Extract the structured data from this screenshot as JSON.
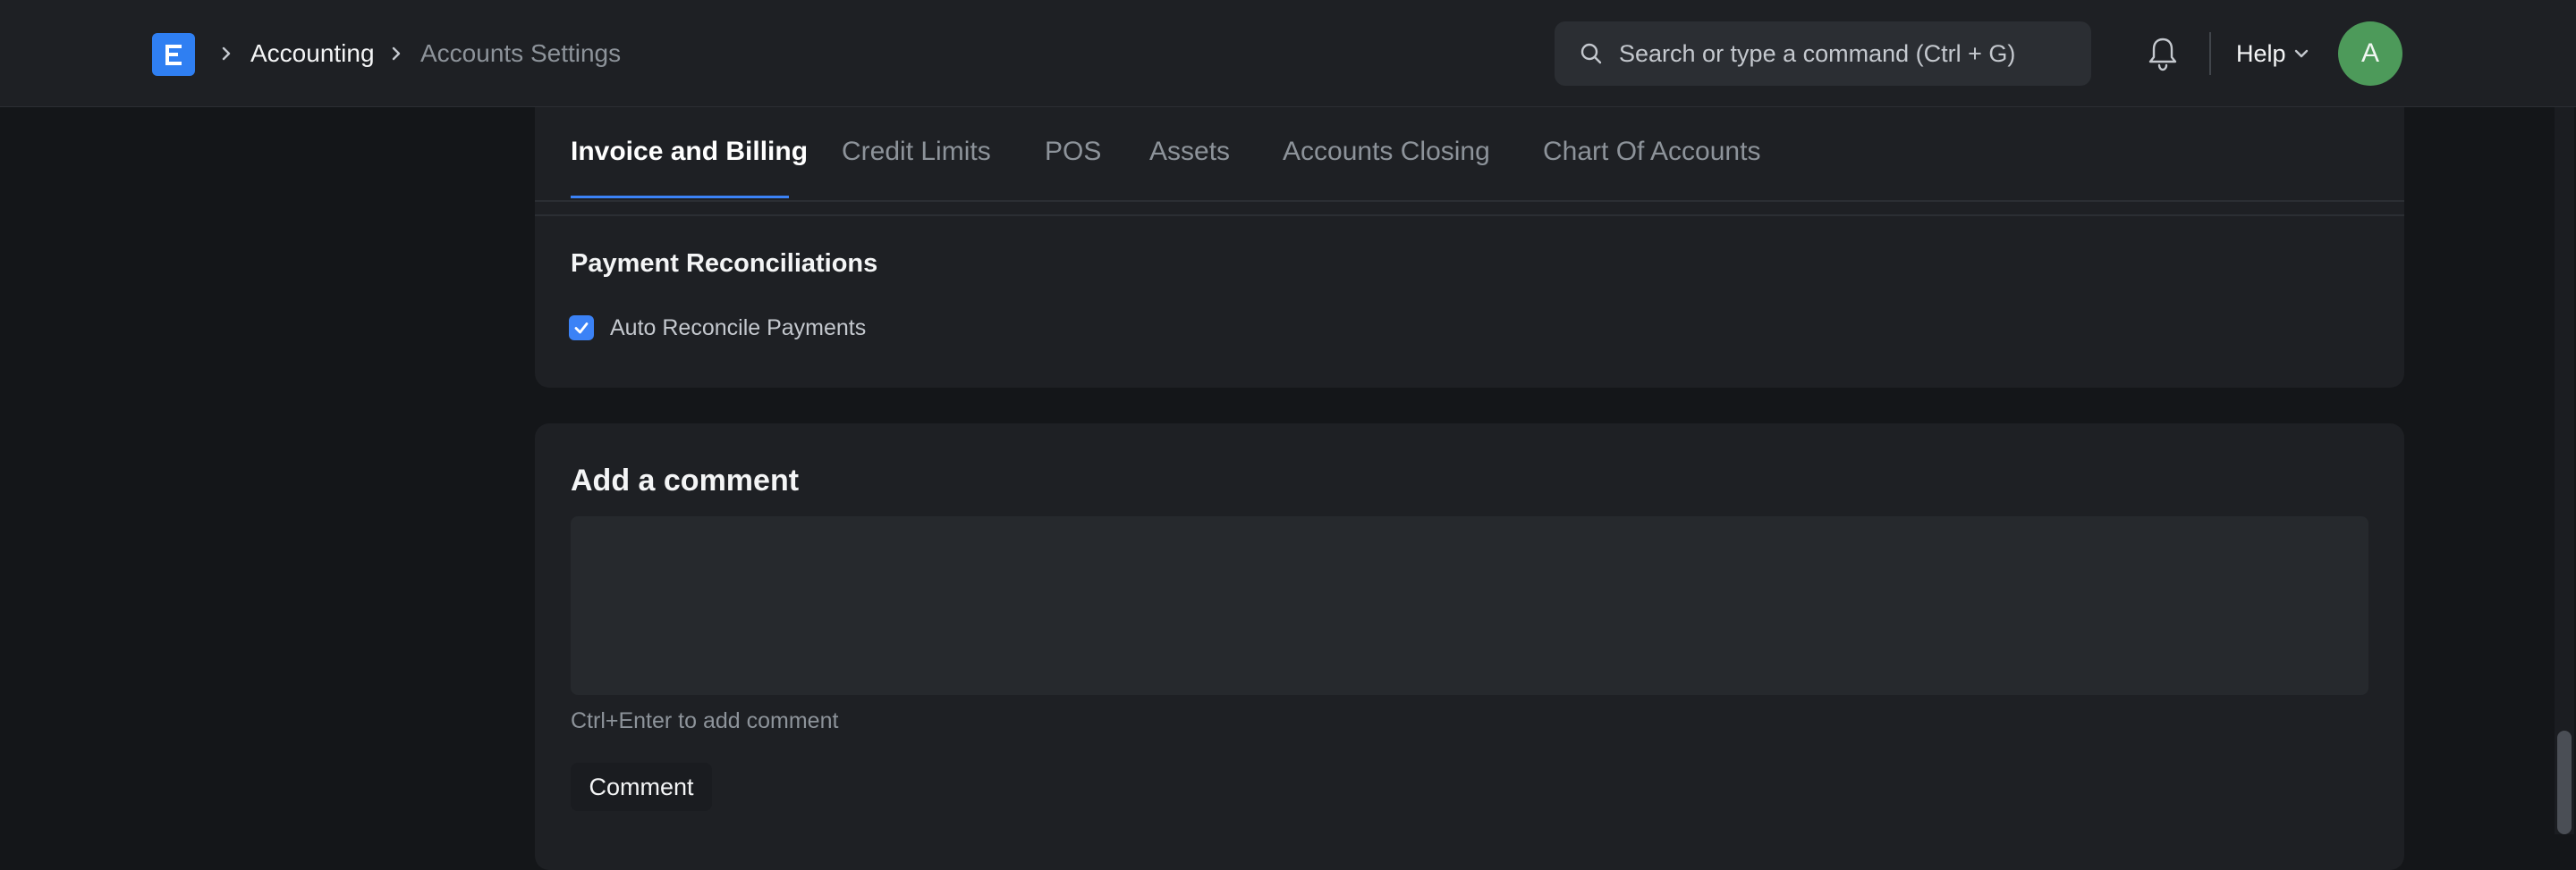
{
  "navbar": {
    "logo_icon": "frappe-logo-icon",
    "breadcrumb": [
      "Accounting",
      "Accounts Settings"
    ],
    "search_placeholder": "Search or type a command (Ctrl + G)",
    "help_label": "Help",
    "avatar_initial": "A",
    "avatar_color": "#4d9a5a",
    "accent_color": "#2f7ff2"
  },
  "tabs": [
    {
      "label": "Invoice and Billing",
      "active": true
    },
    {
      "label": "Credit Limits",
      "active": false
    },
    {
      "label": "POS",
      "active": false
    },
    {
      "label": "Assets",
      "active": false
    },
    {
      "label": "Accounts Closing",
      "active": false
    },
    {
      "label": "Chart Of Accounts",
      "active": false
    }
  ],
  "section": {
    "title": "Payment Reconciliations",
    "checkbox_label": "Auto Reconcile Payments",
    "checkbox_checked": true
  },
  "comment": {
    "title": "Add a comment",
    "value": "",
    "hint": "Ctrl+Enter to add comment",
    "button_label": "Comment"
  }
}
